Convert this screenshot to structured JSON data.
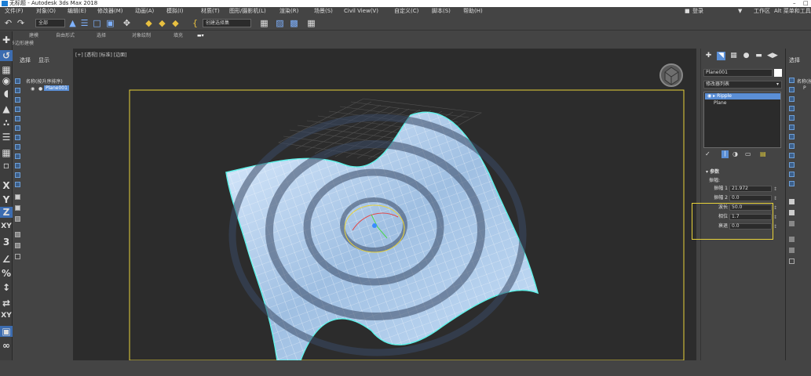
{
  "window": {
    "title": "无标题 - Autodesk 3ds Max 2018",
    "minimize": "–",
    "restore": "□"
  },
  "menu": [
    "文件(F)",
    "对象(O)",
    "编辑(E)",
    "修改器(M)",
    "动画(A)",
    "模拟(I)",
    "材质(T)",
    "图形/摄影机(L)",
    "渲染(R)",
    "场景(S)",
    "Civil View(V)",
    "自定义(C)",
    "脚本(S)",
    "帮助(H)"
  ],
  "menu_right": {
    "user": "登录",
    "workspace": "工作区",
    "workspace_value": "Alt 菜单和工具"
  },
  "toolbar": {
    "filter_dropdown": "全部",
    "selection_set": "创建选择集"
  },
  "ribbon": {
    "tabs": [
      "建模",
      "自由形式",
      "选择",
      "对象绘制",
      "填充"
    ],
    "subtitle": "多边形建模"
  },
  "scene_explorer": {
    "tabs": [
      "选择",
      "显示"
    ],
    "column_header": "名称(按升序排序)",
    "items": [
      "Plane001"
    ]
  },
  "viewport": {
    "label": "[+] [透视] [标准] [边面]"
  },
  "command_panel": {
    "object_name": "Plane001",
    "modifier_list": "修改器列表",
    "stack": [
      "Ripple",
      "Plane"
    ],
    "rollout_title": "参数",
    "amplitude_group": "振幅:",
    "params": [
      {
        "label": "振幅 1",
        "value": "21.972"
      },
      {
        "label": "振幅 2",
        "value": "0.0"
      },
      {
        "label": "波长",
        "value": "50.0"
      },
      {
        "label": "相位",
        "value": "1.7"
      },
      {
        "label": "衰退",
        "value": "0.0"
      }
    ]
  },
  "right_explorer": {
    "tabs": [
      "选择"
    ],
    "column_header": "名称(按",
    "items": [
      "P"
    ]
  },
  "colors": {
    "ui_bg": "#444444",
    "viewport_bg": "#2c2c2c",
    "accent": "#5b8fd6",
    "highlight_frame": "#e8d23a",
    "mesh": "#b8d2ee",
    "mesh_edge": "#5ff0e8"
  }
}
